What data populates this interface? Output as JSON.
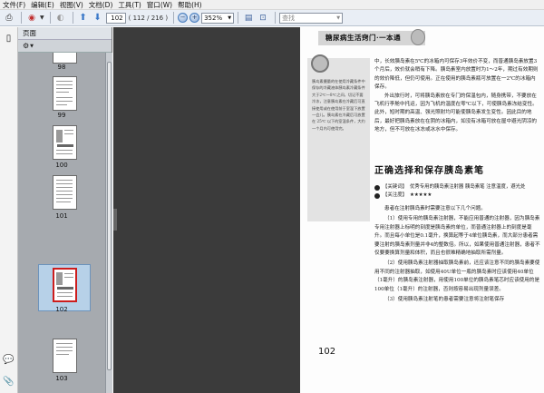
{
  "menu": [
    "文件(F)",
    "编辑(E)",
    "视图(V)",
    "文档(D)",
    "工具(T)",
    "窗口(W)",
    "帮助(H)"
  ],
  "toolbar": {
    "current_page": "102",
    "page_total": "( 112 / 216 )",
    "zoom": "352%",
    "zoom_arrow": "▼",
    "search_placeholder": "查找",
    "search_arrow": "▼",
    "icons": [
      "print-icon",
      "export-icon",
      "back-icon",
      "page-up-icon",
      "page-down-icon",
      "zoom-out-icon",
      "zoom-in-icon",
      "save-icon",
      "fit-page-icon"
    ]
  },
  "panel": {
    "title": "页面",
    "options_icon": "gear-icon",
    "thumbnails": [
      {
        "label": "98"
      },
      {
        "label": "99"
      },
      {
        "label": "100"
      },
      {
        "label": "101"
      },
      {
        "label": "102",
        "selected": true
      },
      {
        "label": "103"
      }
    ]
  },
  "page": {
    "header_banner": "糖尿病生活窍门·一本通",
    "sidebox_text": "胰岛素摄量的在使用冷藏条件中保存的冷藏液体胰岛素冷藏条件大于2℃一8℃之间，切记不要冷冻，注意胰岛素在冷藏后可直接使用或在使用前于室温下放置一会儿。胰岛素在冷藏后可放置在 25℃ 以下的室温条件，大约一个月内可使用完。",
    "body1": [
      "中，长效胰岛素在5℃的冰箱内可保存3年效价不变，而普通胰岛素放置3个月后，效价就会稍有下降。胰岛素室内放置时为1～2年，期过有效期则的效价降低，但仍可使用。正在使用的胰岛素瓶可放置在一2℃的冰箱内保存。",
      "外出旅行时，可将胰岛素放在专门的保温包内，随身携带，不要放在飞机行李舱中托运，因为飞机的温度在零℃以下，可使胰岛素冻结变性。此外，短时期的高温、强光照射均可能使胰岛素发生变性。因此目的地后，最好把胰岛素放在在阴的冰箱内，如没有冰箱可放在屋中避光阴凉的地方，但不可放在冰冻或冰水中保存。"
    ],
    "section_title": "正确选择和保存胰岛素笔",
    "keywords_label": "关键词",
    "keywords": "优秀专用的胰岛素注射器  胰岛素笔  注意温度，避光处",
    "importance_label": "关注度",
    "importance_stars": "★★★★★",
    "body2": [
      "患者在注射胰岛素时需要注意以下几个问题。",
      "（1）使用专用的胰岛素注射器，不能应用普通的注射器，因为胰岛素专用注射器上标明的刻度是胰岛素的单位，而普通注射器上的刻度是毫升。而且每小单位是0.1毫升，换算起等于4单位胰岛素，而大部分患者需要注射的胰岛素剂量并非4的整数倍。所以，如果使用普通注射器，患者不仅要要换算剂量和体积，而且也很难精确地抽取所需剂量。",
      "（2）使用胰岛素注射器抽取胰岛素前，还应该注意不同的胰岛素要使用不同的注射器抽取，如使用40U单位一瓶的胰岛素时应该使用40单位（1毫升）的胰岛素注射器，用使用100单位的胰岛素笔芯时应该使用的是100单位（1毫升）的注射器，否则按容易出现剂量误差。",
      "（3）使用胰岛素注射笔的患者需要注意将注射笔保存"
    ],
    "page_number": "102"
  }
}
